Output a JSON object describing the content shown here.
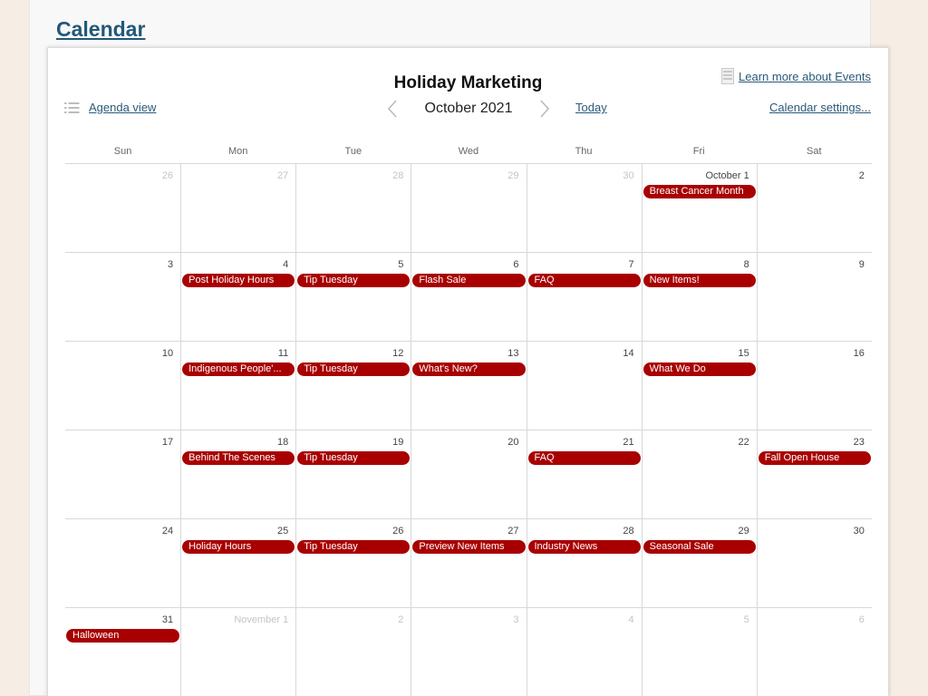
{
  "page": {
    "title": "Calendar"
  },
  "calendar": {
    "title": "Holiday Marketing",
    "learn_more": "Learn more about Events",
    "agenda_label": "Agenda view",
    "month_label": "October 2021",
    "today_label": "Today",
    "settings_label": "Calendar settings...",
    "days_of_week": [
      "Sun",
      "Mon",
      "Tue",
      "Wed",
      "Thu",
      "Fri",
      "Sat"
    ],
    "event_color": "#a80000",
    "weeks": [
      [
        {
          "day": "26",
          "other": true,
          "event": ""
        },
        {
          "day": "27",
          "other": true,
          "event": ""
        },
        {
          "day": "28",
          "other": true,
          "event": ""
        },
        {
          "day": "29",
          "other": true,
          "event": ""
        },
        {
          "day": "30",
          "other": true,
          "event": ""
        },
        {
          "day": "October 1",
          "other": false,
          "event": "Breast Cancer Month"
        },
        {
          "day": "2",
          "other": false,
          "event": ""
        }
      ],
      [
        {
          "day": "3",
          "other": false,
          "event": ""
        },
        {
          "day": "4",
          "other": false,
          "event": "Post Holiday Hours"
        },
        {
          "day": "5",
          "other": false,
          "event": "Tip Tuesday"
        },
        {
          "day": "6",
          "other": false,
          "event": "Flash Sale"
        },
        {
          "day": "7",
          "other": false,
          "event": "FAQ"
        },
        {
          "day": "8",
          "other": false,
          "event": "New Items!"
        },
        {
          "day": "9",
          "other": false,
          "event": ""
        }
      ],
      [
        {
          "day": "10",
          "other": false,
          "event": ""
        },
        {
          "day": "11",
          "other": false,
          "event": "Indigenous People'..."
        },
        {
          "day": "12",
          "other": false,
          "event": "Tip Tuesday"
        },
        {
          "day": "13",
          "other": false,
          "event": "What's New?"
        },
        {
          "day": "14",
          "other": false,
          "event": ""
        },
        {
          "day": "15",
          "other": false,
          "event": "What We Do"
        },
        {
          "day": "16",
          "other": false,
          "event": ""
        }
      ],
      [
        {
          "day": "17",
          "other": false,
          "event": ""
        },
        {
          "day": "18",
          "other": false,
          "event": "Behind The Scenes"
        },
        {
          "day": "19",
          "other": false,
          "event": "Tip Tuesday"
        },
        {
          "day": "20",
          "other": false,
          "event": ""
        },
        {
          "day": "21",
          "other": false,
          "event": "FAQ"
        },
        {
          "day": "22",
          "other": false,
          "event": ""
        },
        {
          "day": "23",
          "other": false,
          "event": "Fall Open House"
        }
      ],
      [
        {
          "day": "24",
          "other": false,
          "event": ""
        },
        {
          "day": "25",
          "other": false,
          "event": "Holiday Hours"
        },
        {
          "day": "26",
          "other": false,
          "event": "Tip Tuesday"
        },
        {
          "day": "27",
          "other": false,
          "event": "Preview New Items"
        },
        {
          "day": "28",
          "other": false,
          "event": "Industry News"
        },
        {
          "day": "29",
          "other": false,
          "event": "Seasonal Sale"
        },
        {
          "day": "30",
          "other": false,
          "event": ""
        }
      ],
      [
        {
          "day": "31",
          "other": false,
          "event": "Halloween"
        },
        {
          "day": "November 1",
          "other": true,
          "event": ""
        },
        {
          "day": "2",
          "other": true,
          "event": ""
        },
        {
          "day": "3",
          "other": true,
          "event": ""
        },
        {
          "day": "4",
          "other": true,
          "event": ""
        },
        {
          "day": "5",
          "other": true,
          "event": ""
        },
        {
          "day": "6",
          "other": true,
          "event": ""
        }
      ]
    ]
  }
}
